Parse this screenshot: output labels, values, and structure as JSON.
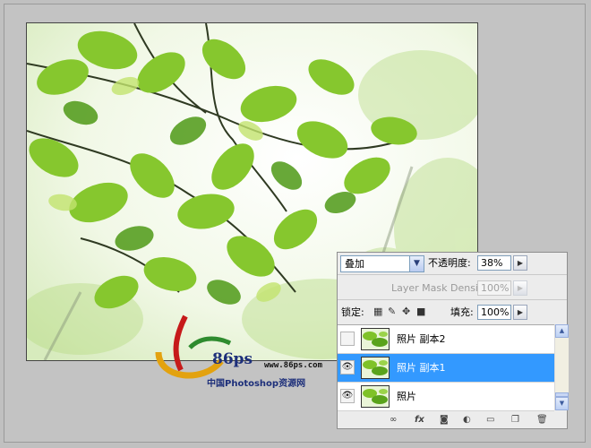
{
  "layers_panel": {
    "blend_mode": "叠加",
    "opacity_label": "不透明度:",
    "opacity_value": "38%",
    "mask_density_label": "Layer Mask Density",
    "mask_density_value": "100%",
    "lock_label": "锁定:",
    "fill_label": "填充:",
    "fill_value": "100%",
    "layers": [
      {
        "name": "照片 副本2",
        "visible": false,
        "selected": false
      },
      {
        "name": "照片 副本1",
        "visible": true,
        "selected": true
      },
      {
        "name": "照片",
        "visible": true,
        "selected": false
      }
    ],
    "footer_icons": [
      "link-icon",
      "fx-icon",
      "mask-icon",
      "adjustment-icon",
      "folder-icon",
      "new-layer-icon",
      "trash-icon"
    ],
    "fx_label": "fx"
  },
  "watermark": {
    "brand": "86ps",
    "site": "www.86ps.com",
    "name": "中国Photoshop资源网"
  },
  "colors": {
    "selection": "#3399ff",
    "leaf": "#7fc228",
    "background": "#c0c0c0"
  }
}
